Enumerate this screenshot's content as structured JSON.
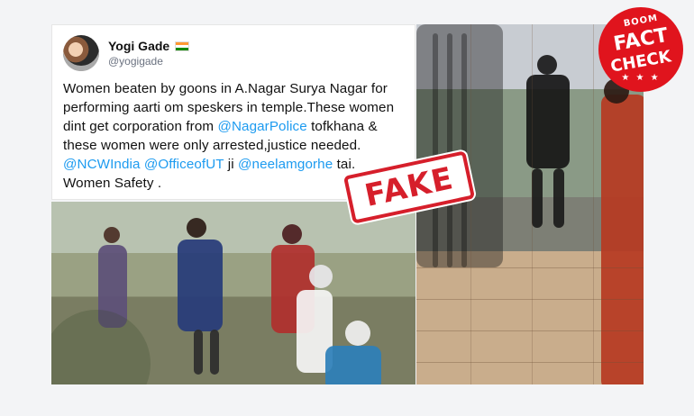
{
  "tweet": {
    "name": "Yogi Gade",
    "handle": "@yogigade",
    "text_segments": [
      {
        "text": "Women beaten by goons in A.Nagar Surya Nagar for performing aarti om spe",
        "mention": false
      },
      {
        "text": "skers in temple.These women dint get corporation from ",
        "mention": false
      },
      {
        "text": "@NagarPolice",
        "mention": true
      },
      {
        "text": " tofkhana & these women were only arrested,justice needed. ",
        "mention": false
      },
      {
        "text": "@NCWIndia",
        "mention": true
      },
      {
        "text": " ",
        "mention": false
      },
      {
        "text": "@OfficeofUT",
        "mention": true
      },
      {
        "text": " ji ",
        "mention": false
      },
      {
        "text": "@neelamgorhe",
        "mention": true
      },
      {
        "text": " tai. Women Safety .",
        "mention": false
      }
    ],
    "flag_icon": "india-flag-icon"
  },
  "overlays": {
    "fake_label": "FAKE",
    "fact_check": {
      "brand": "BOOM",
      "line1": "FACT",
      "line2": "CHECK",
      "stars": "★ ★ ★"
    }
  },
  "colors": {
    "mention": "#1d9bf0",
    "fake": "#d61f2b",
    "fact_check": "#e0141d"
  }
}
